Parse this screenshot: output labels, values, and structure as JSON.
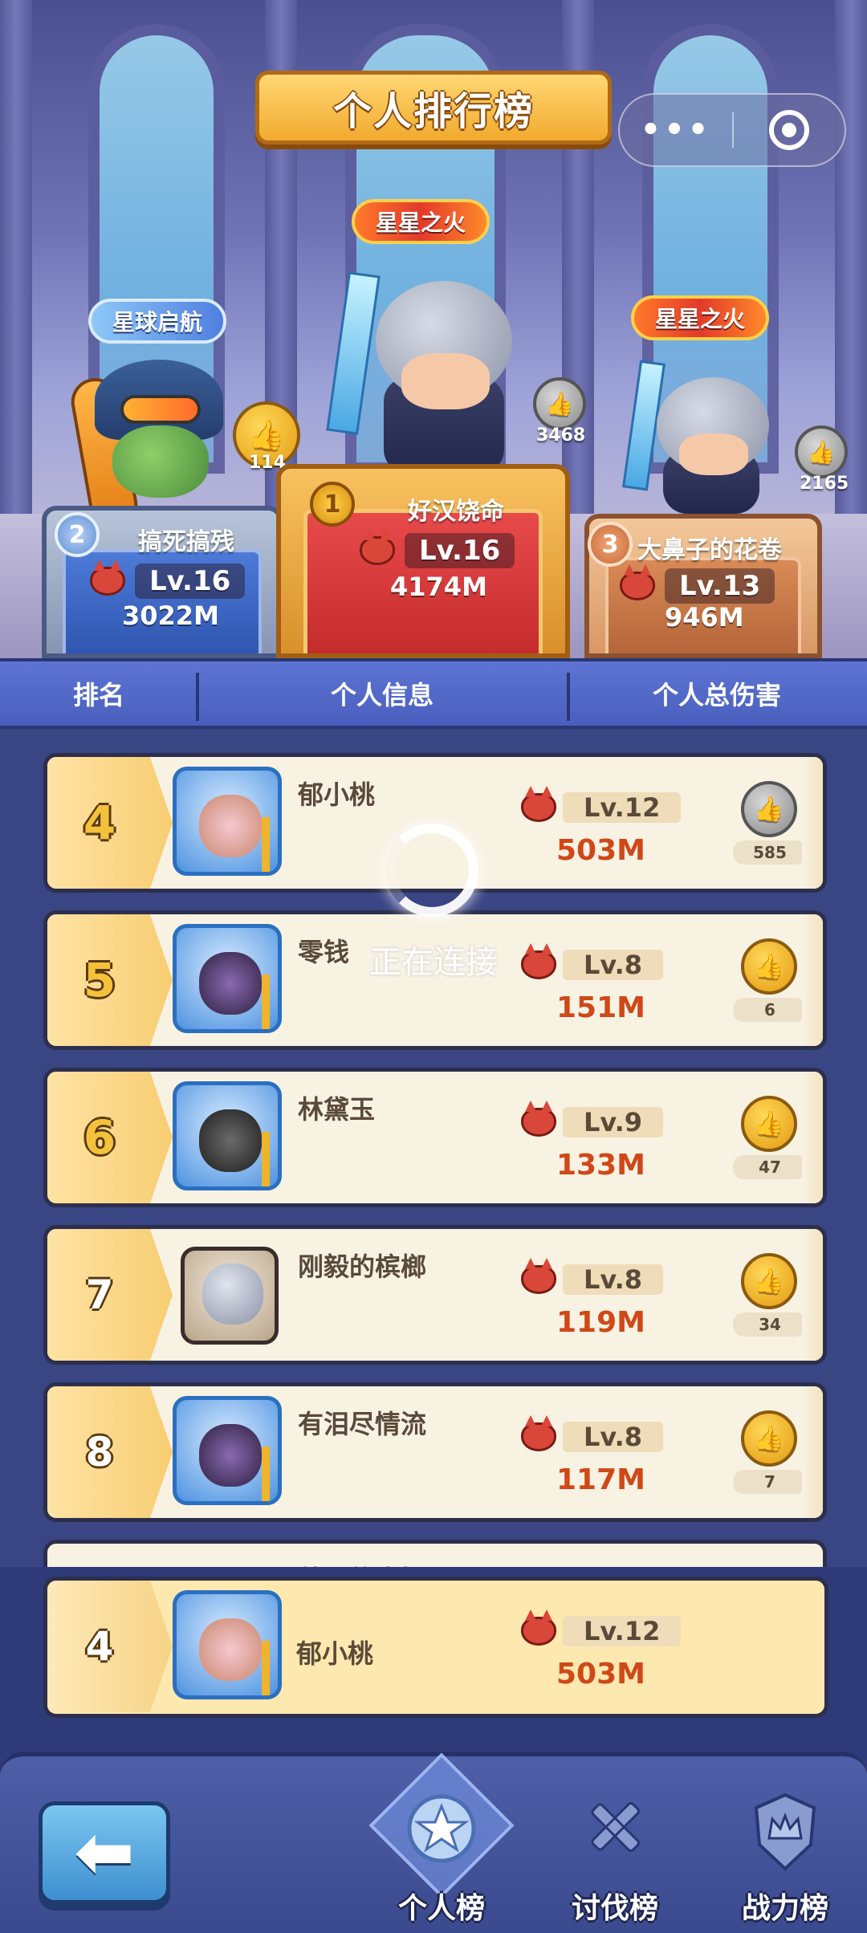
{
  "title": "个人排行榜",
  "capsule": {
    "menu_glyph": "•••",
    "close_glyph": "◎"
  },
  "podium": [
    {
      "rank": "1",
      "title_tag": "星星之火",
      "name": "好汉饶命",
      "level": "Lv.16",
      "damage": "4174M",
      "likes": "3468",
      "like_style": "grey"
    },
    {
      "rank": "2",
      "title_tag": "星球启航",
      "name": "搞死搞残",
      "level": "Lv.16",
      "damage": "3022M",
      "likes": "114",
      "like_style": "gold"
    },
    {
      "rank": "3",
      "title_tag": "星星之火",
      "name": "大鼻子的花卷",
      "level": "Lv.13",
      "damage": "946M",
      "likes": "2165",
      "like_style": "grey"
    }
  ],
  "columns": {
    "rank": "排名",
    "info": "个人信息",
    "damage": "个人总伤害"
  },
  "list": [
    {
      "rank": "4",
      "name": "郁小桃",
      "level": "Lv.12",
      "damage": "503M",
      "likes": "585",
      "like_style": "grey",
      "avatar": "pink-bear"
    },
    {
      "rank": "5",
      "name": "零钱",
      "level": "Lv.8",
      "damage": "151M",
      "likes": "6",
      "like_style": "gold",
      "avatar": "dark-beast"
    },
    {
      "rank": "6",
      "name": "林黛玉",
      "level": "Lv.9",
      "damage": "133M",
      "likes": "47",
      "like_style": "gold",
      "avatar": "black-cat"
    },
    {
      "rank": "7",
      "name": "刚毅的槟榔",
      "level": "Lv.8",
      "damage": "119M",
      "likes": "34",
      "like_style": "gold",
      "avatar": "silver-knight"
    },
    {
      "rank": "8",
      "name": "有泪尽情流",
      "level": "Lv.8",
      "damage": "117M",
      "likes": "7",
      "like_style": "gold",
      "avatar": "dark-beast"
    }
  ],
  "partial_row_name": "帅哥的麦椒",
  "loading_text": "正在连接",
  "self": {
    "rank": "4",
    "name": "郁小桃",
    "level": "Lv.12",
    "damage": "503M",
    "avatar": "pink-bear"
  },
  "nav": {
    "back_glyph": "⬅",
    "tabs": [
      {
        "label": "个人榜",
        "active": true
      },
      {
        "label": "讨伐榜",
        "active": false
      },
      {
        "label": "战力榜",
        "active": false
      }
    ]
  },
  "colors": {
    "accent_gold": "#f4c23a",
    "damage_red": "#d04818",
    "header_blue": "#4a5fbd",
    "row_bg": "#f8f2e3"
  }
}
